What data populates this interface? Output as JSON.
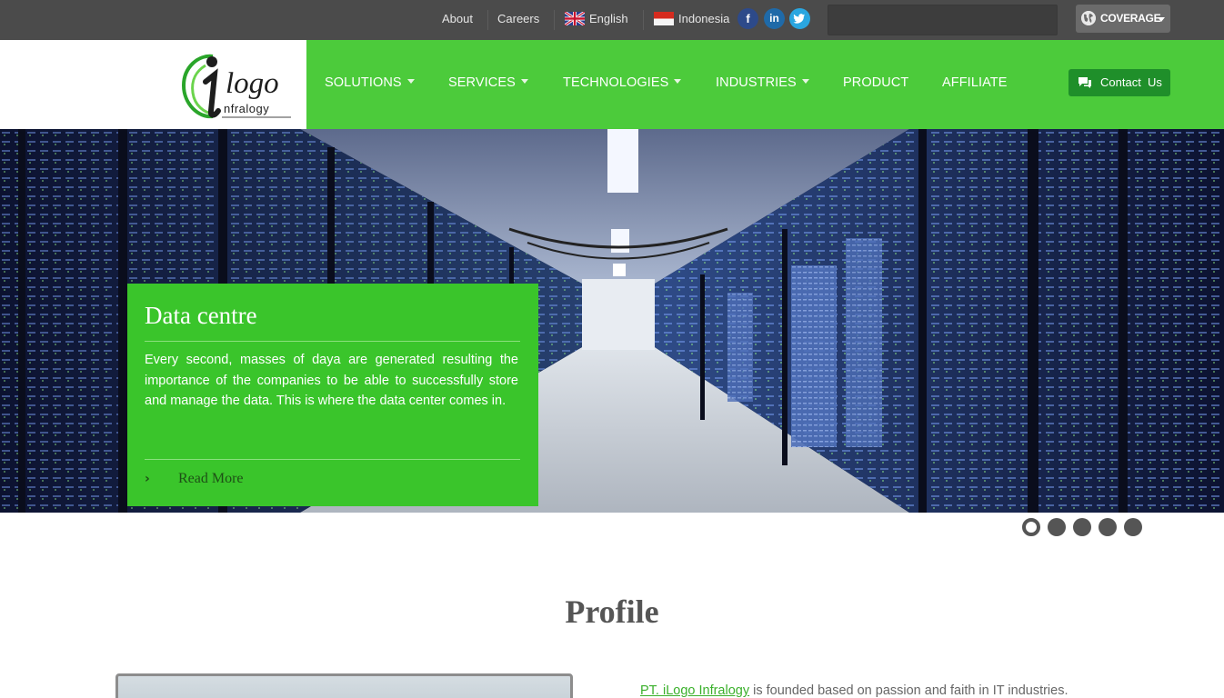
{
  "topbar": {
    "about": "About",
    "careers": "Careers",
    "lang_english": "English",
    "lang_indonesia": "Indonesia",
    "social": {
      "facebook": "f",
      "linkedin": "in",
      "twitter": "twitter-icon"
    },
    "search": {
      "value": "",
      "placeholder": ""
    },
    "coverage": "COVERAGE"
  },
  "header": {
    "logo_alt": "iLogo Infralogy",
    "nav": [
      {
        "label": "SOLUTIONS",
        "dropdown": true
      },
      {
        "label": "SERVICES",
        "dropdown": true
      },
      {
        "label": "TECHNOLOGIES",
        "dropdown": true
      },
      {
        "label": "INDUSTRIES",
        "dropdown": true
      },
      {
        "label": "PRODUCT",
        "dropdown": false
      },
      {
        "label": "AFFILIATE",
        "dropdown": false
      }
    ],
    "contact": "Contact  Us"
  },
  "hero": {
    "title": "Data centre",
    "text": "Every second, masses of daya are generated resulting the importance of the companies to be able to successfully store and manage the data. This is where the data center comes in.",
    "read_more": "Read More",
    "slides": 5,
    "active_slide": 1
  },
  "profile": {
    "title": "Profile",
    "company": "PT. iLogo Infralogy",
    "text": " is founded based on passion and faith in IT industries."
  },
  "colors": {
    "topbar": "#4b4b4b",
    "nav_green": "#4ccb3b",
    "caption_green": "#3ac52b",
    "contact_green": "#1f8f2a"
  }
}
